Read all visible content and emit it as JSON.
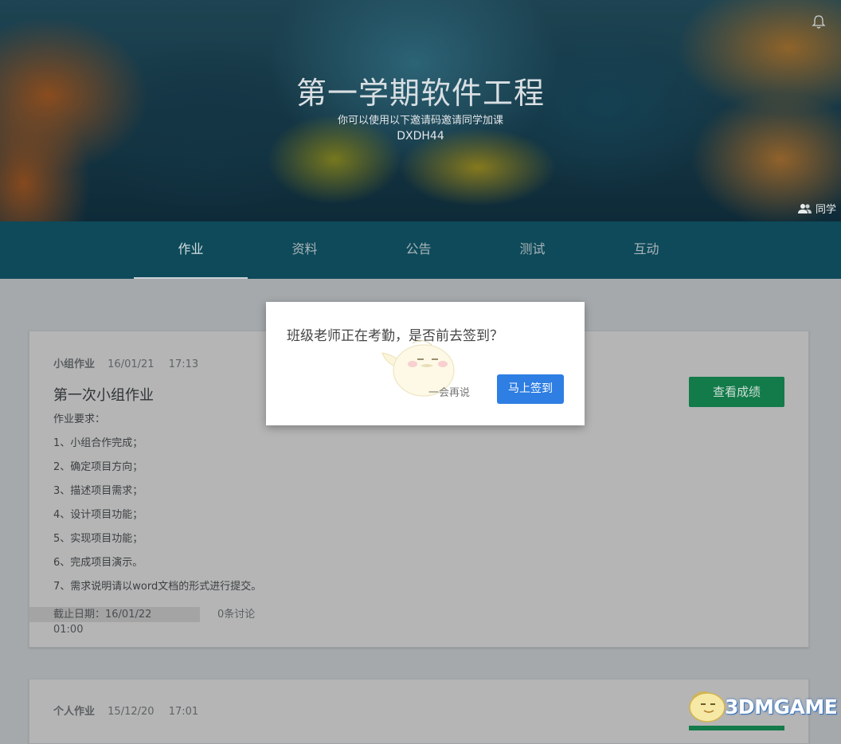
{
  "banner": {
    "title": "第一学期软件工程",
    "subtitle": "你可以使用以下邀请码邀请同学加课",
    "invite_code": "DXDH44",
    "classmates_label": "同学"
  },
  "nav": {
    "tabs": [
      {
        "label": "作业",
        "active": true
      },
      {
        "label": "资料",
        "active": false
      },
      {
        "label": "公告",
        "active": false
      },
      {
        "label": "测试",
        "active": false
      },
      {
        "label": "互动",
        "active": false
      }
    ]
  },
  "assignments": [
    {
      "type": "小组作业",
      "date": "16/01/21",
      "time": "17:13",
      "title": "第一次小组作业",
      "requirements": [
        "作业要求：",
        "1、小组合作完成；",
        "2、确定项目方向；",
        "3、描述项目需求；",
        "4、设计项目功能；",
        "5、实现项目功能；",
        "6、完成项目演示。",
        "7、需求说明请以word文档的形式进行提交。"
      ],
      "deadline": "截止日期：16/01/22  01:00",
      "discussions": "0条讨论",
      "grade_button": "查看成绩"
    },
    {
      "type": "个人作业",
      "date": "15/12/20",
      "time": "17:01"
    }
  ],
  "modal": {
    "message": "班级老师正在考勤，是否前去签到？",
    "later_label": "一会再说",
    "confirm_label": "马上签到"
  },
  "watermark": {
    "text": "3DMGAME"
  },
  "colors": {
    "nav_bg": "#0e4a5a",
    "primary_button": "#2e7ee3",
    "grade_button": "#137a4a"
  }
}
